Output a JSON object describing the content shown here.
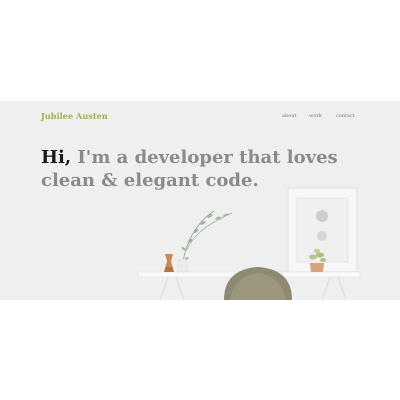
{
  "header": {
    "brand": "Jubilee Austen",
    "nav": [
      {
        "label": "about"
      },
      {
        "label": "work"
      },
      {
        "label": "contact"
      }
    ]
  },
  "hero": {
    "headline_strong": "Hi,",
    "headline_line1": " I'm a developer that loves",
    "headline_line2": "clean & elegant code."
  },
  "colors": {
    "brand": "#9bb04a",
    "headline_muted": "#8a8a88",
    "headline_strong": "#1a1a1a",
    "hero_bg": "#efefef"
  }
}
